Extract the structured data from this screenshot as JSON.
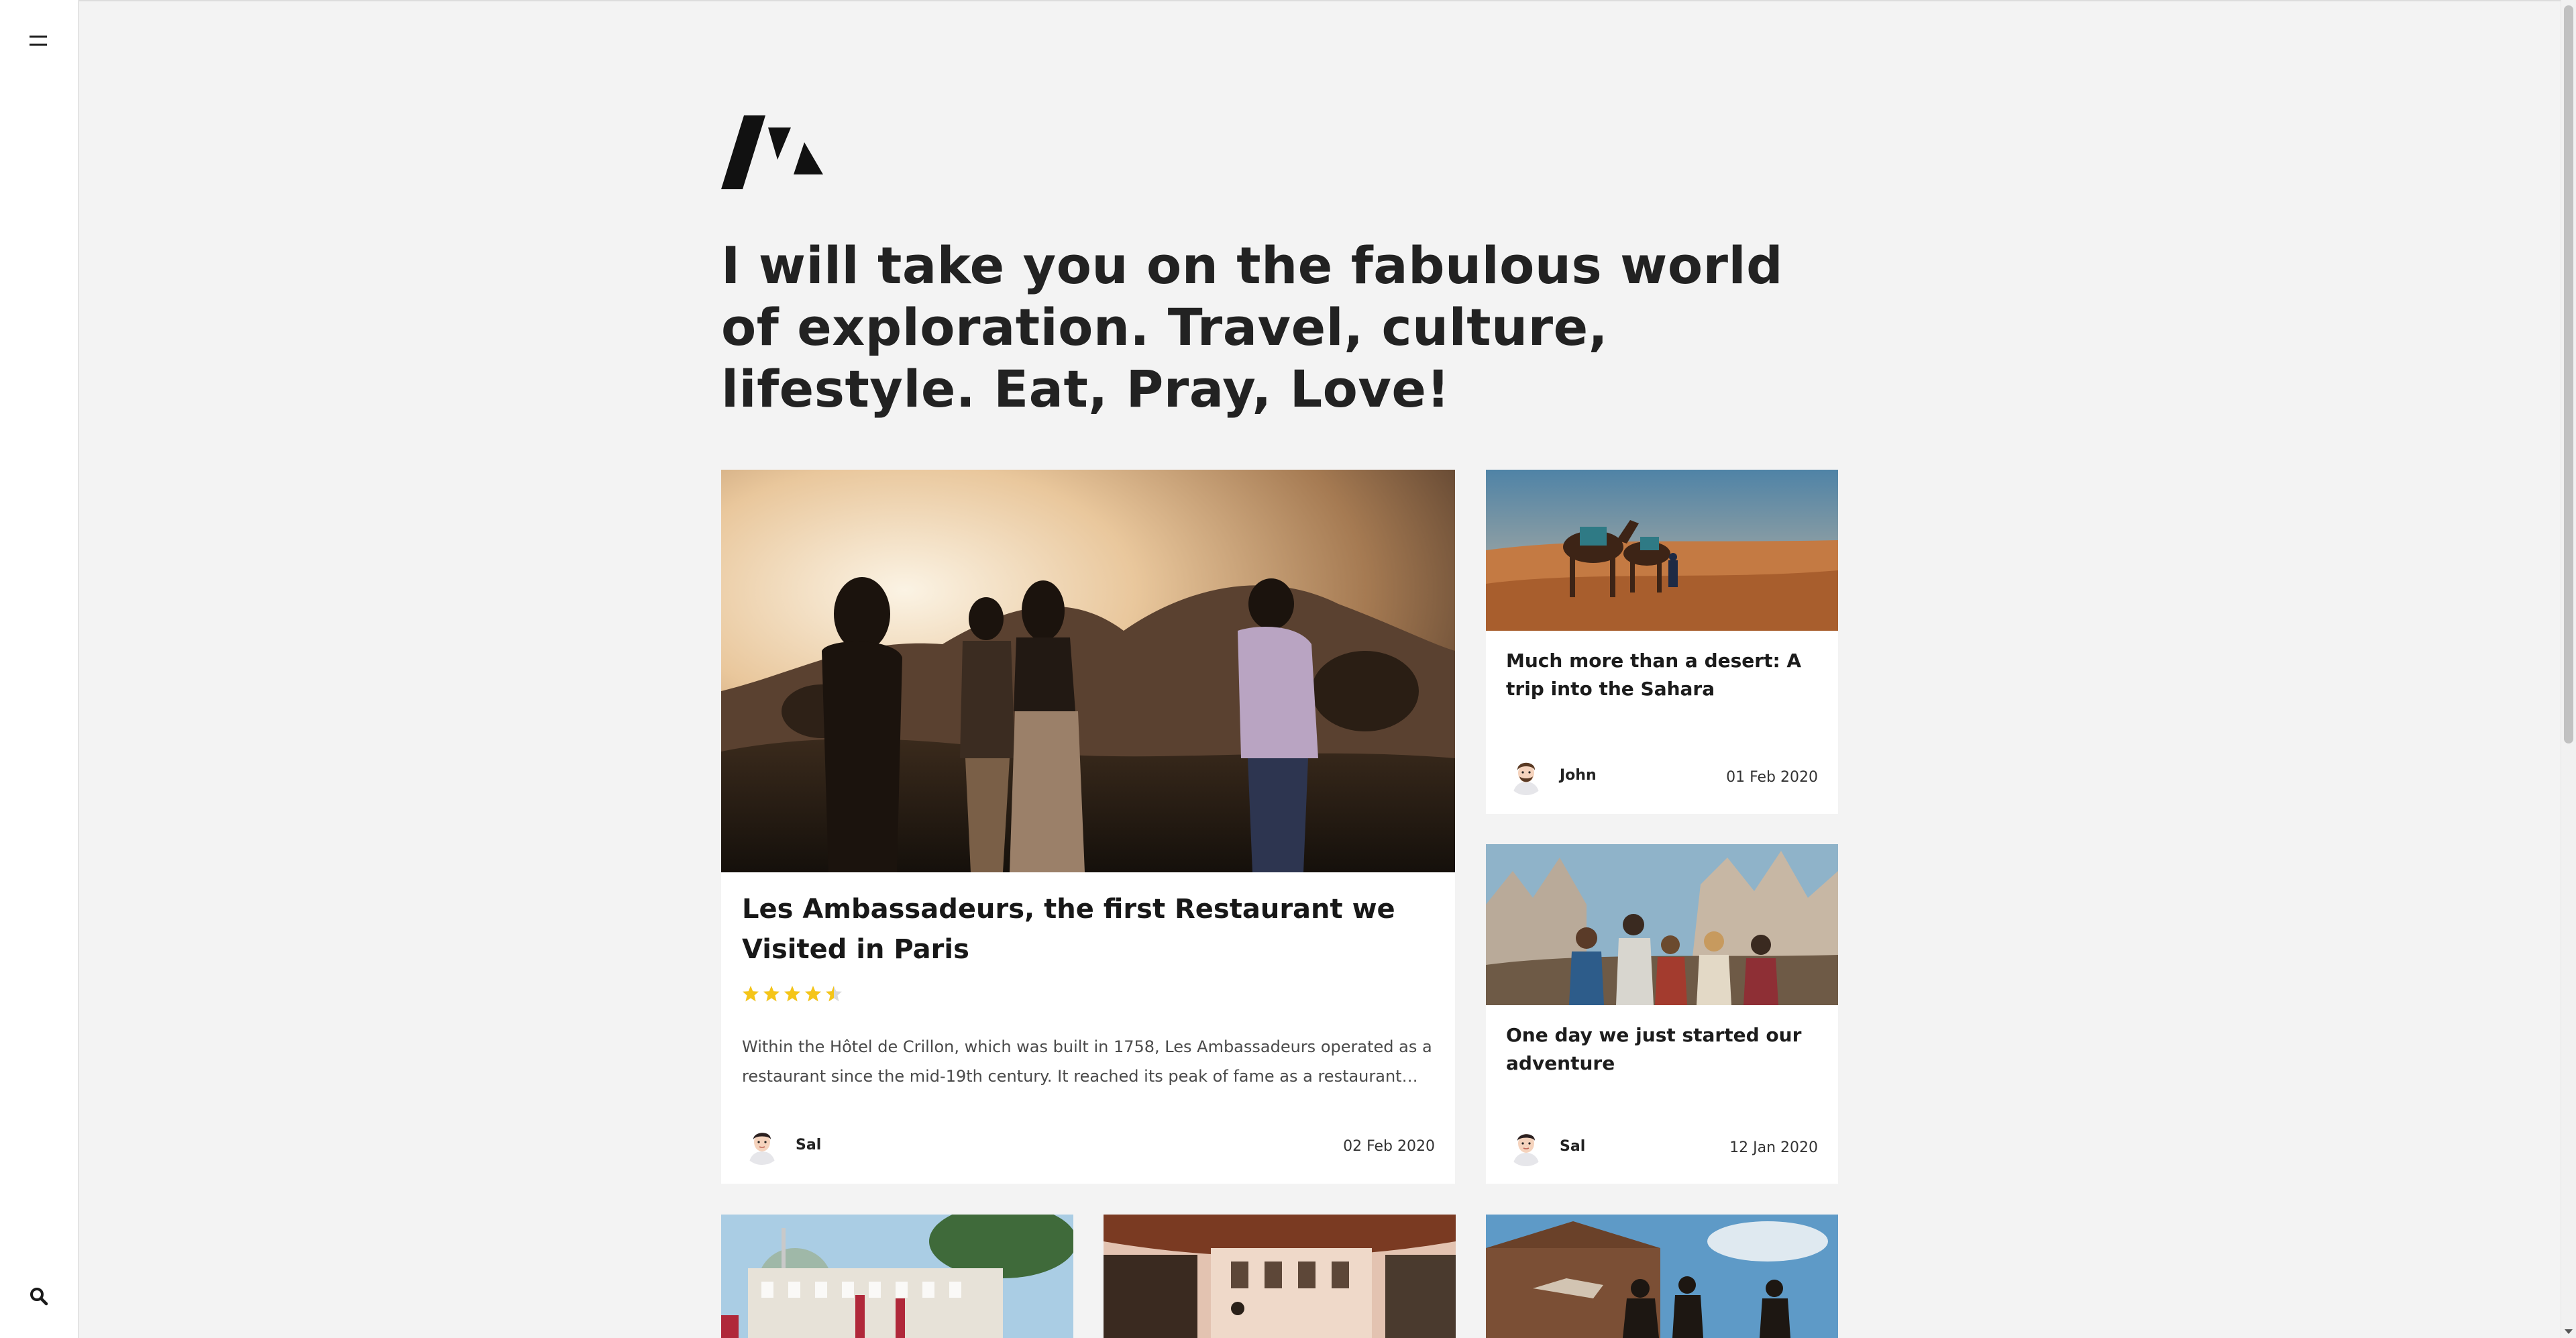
{
  "sidebar": {
    "menu_icon": "hamburger-menu-icon",
    "search_icon": "search-icon"
  },
  "brand": {
    "logo_icon": "brand-logo-icon"
  },
  "hero": {
    "tagline": "I will take you on the fabulous world of exploration. Travel, culture, lifestyle. Eat, Pray, Love!"
  },
  "colors": {
    "background": "#f3f3f3",
    "card": "#ffffff",
    "star": "#f5c518",
    "text": "#1c1c1c"
  },
  "featured": {
    "title": "Les Ambassadeurs, the first Restaurant we Visited in Paris",
    "rating": 4.5,
    "rating_max": 5,
    "excerpt": "Within the Hôtel de Crillon, which was built in 1758, Les Ambassadeurs operated as a restaurant since the mid-19th century. It reached its peak of fame as a restaurant and...",
    "author": "Sal",
    "date": "02 Feb 2020"
  },
  "side_posts": [
    {
      "title": "Much more than a desert: A trip into the Sahara",
      "author": "John",
      "date": "01 Feb 2020"
    },
    {
      "title": "One day we just started our adventure",
      "author": "Sal",
      "date": "12 Jan 2020"
    }
  ]
}
